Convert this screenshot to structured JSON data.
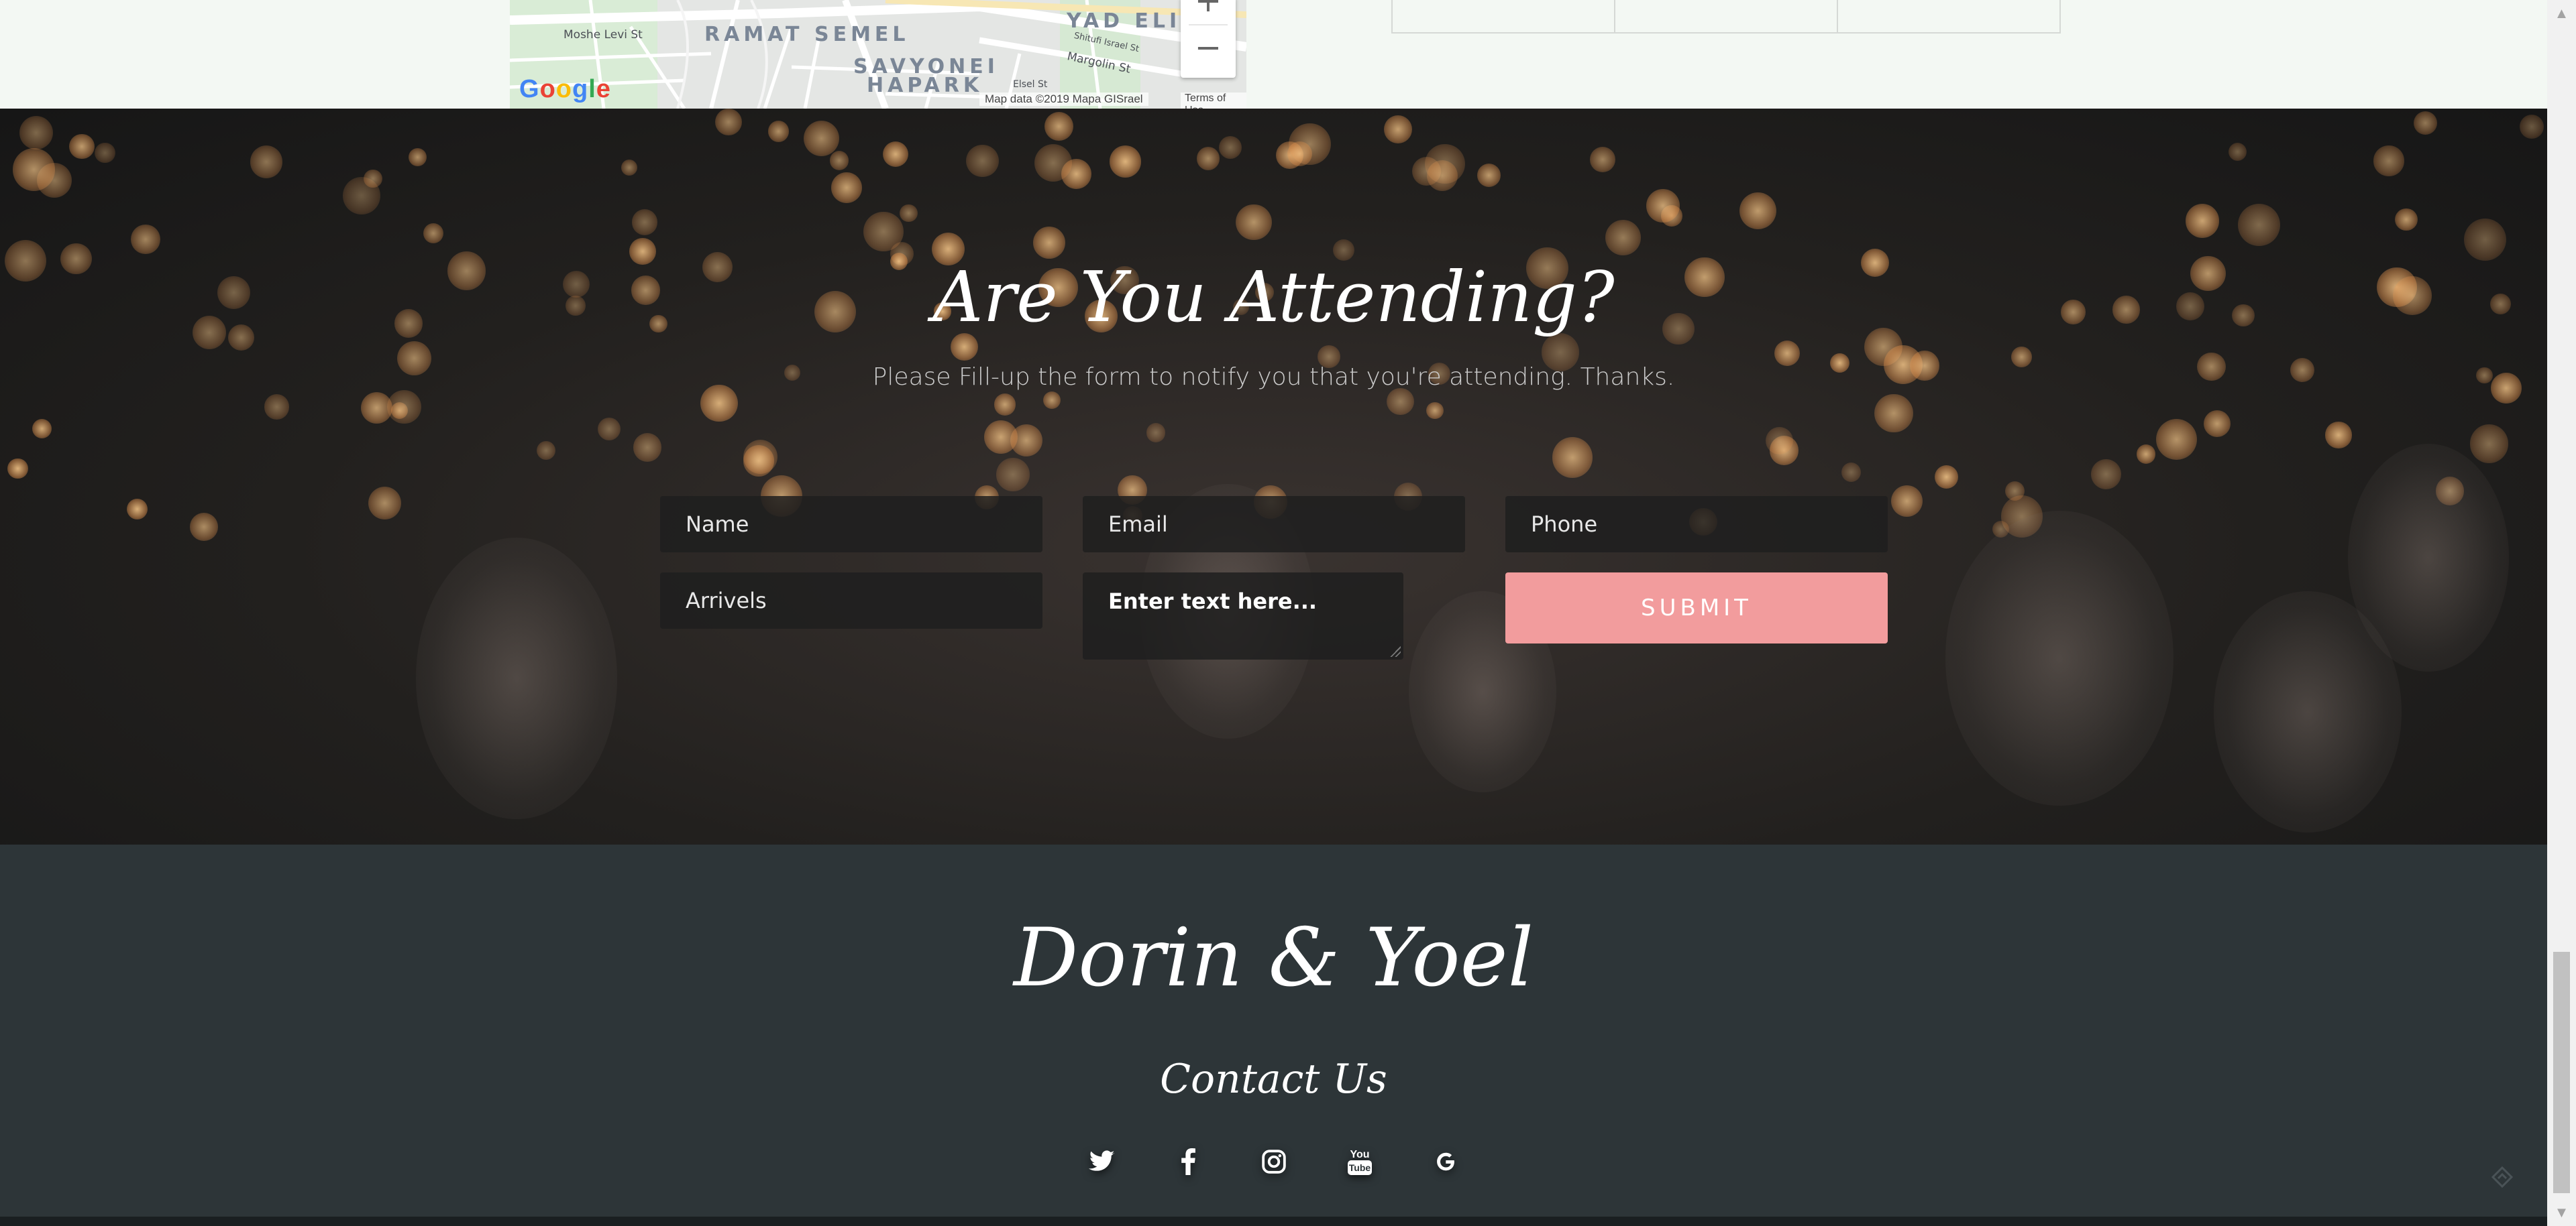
{
  "map": {
    "labels": {
      "ramat_semel": "RAMAT SEMEL",
      "yad_eliyahu": "YAD ELIY",
      "savyonei": "SAVYONEI",
      "hapark": "HAPARK",
      "moshe_levi": "Moshe Levi St",
      "margolin": "Margolin St",
      "shitufi": "Shitufi Israel St",
      "elsel": "Elsel St"
    },
    "zoom_in": "+",
    "zoom_out": "−",
    "google": "Google",
    "attribution": "Map data ©2019 Mapa GISrael",
    "terms": "Terms of Use"
  },
  "rsvp": {
    "heading": "Are You Attending?",
    "subheading": "Please Fill-up the form to notify you that you're attending. Thanks.",
    "name_placeholder": "Name",
    "email_placeholder": "Email",
    "phone_placeholder": "Phone",
    "arrivals_placeholder": "Arrivels",
    "message_placeholder": "Enter text here...",
    "submit_label": "SUBMIT"
  },
  "footer": {
    "couple": "Dorin & Yoel",
    "contact_heading": "Contact Us",
    "social_icons": [
      "twitter-icon",
      "facebook-icon",
      "instagram-icon",
      "youtube-icon",
      "google-icon"
    ],
    "youtube_you": "You",
    "youtube_tube": "Tube"
  },
  "colors": {
    "submit": "#f29c9d",
    "footer_bg": "#2d3538",
    "top_bg": "#f3f8f3"
  }
}
